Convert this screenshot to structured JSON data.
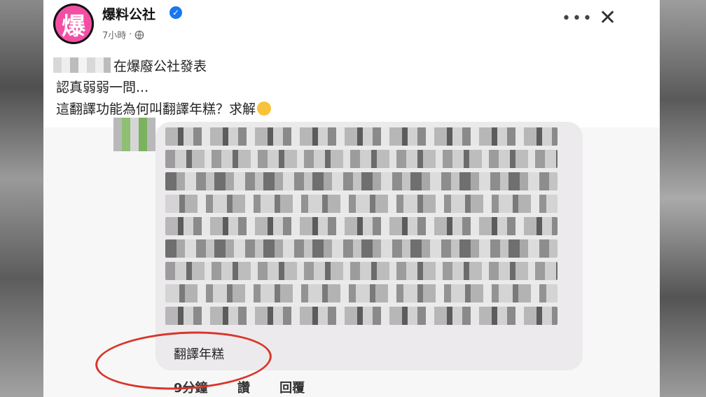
{
  "post": {
    "page_name": "爆料公社",
    "avatar_text": "爆",
    "time": "7小時",
    "text_line1": "在爆廢公社發表",
    "text_line2": "認真弱弱一問...",
    "text_line3": "這翻譯功能為何叫翻譯年糕？求解"
  },
  "comment": {
    "translate_link": "翻譯年糕",
    "time": "9分鐘",
    "like_label": "讚",
    "reply_label": "回覆"
  },
  "colors": {
    "avatar": "#f24fa4",
    "verified": "#1877f2",
    "annotation_circle": "#d9352a"
  },
  "icons": {
    "more": "more-icon",
    "close": "close-icon",
    "globe": "globe-icon",
    "verified": "verified-badge-icon",
    "emoji": "thinking-emoji-icon"
  }
}
